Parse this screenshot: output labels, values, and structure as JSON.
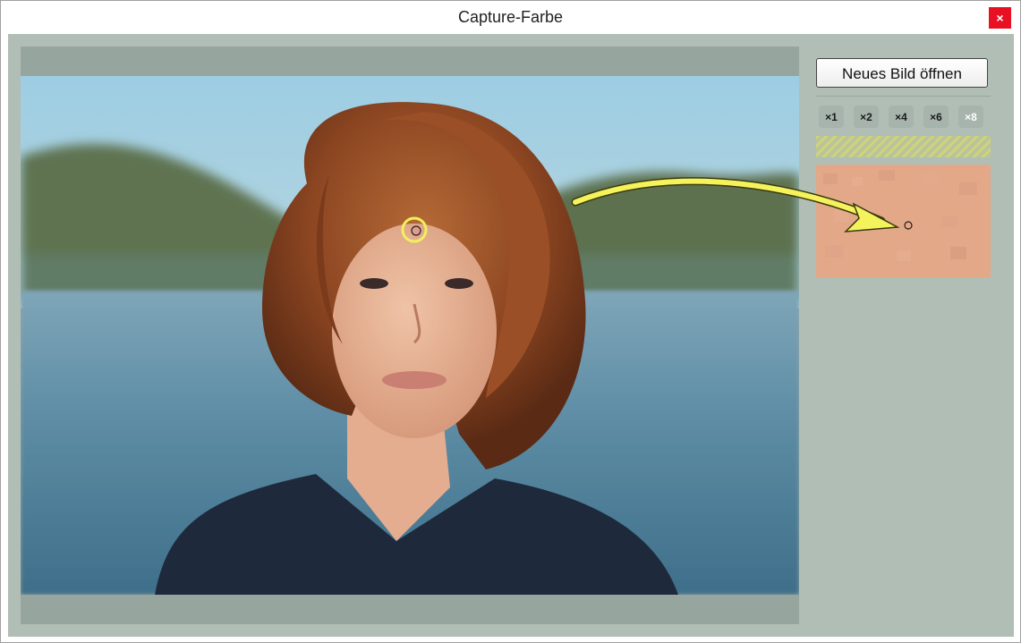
{
  "window": {
    "title": "Capture-Farbe",
    "close_glyph": "×"
  },
  "sidebar": {
    "open_button_label": "Neues Bild öffnen",
    "zoom_options": [
      {
        "label": "×1",
        "active": false
      },
      {
        "label": "×2",
        "active": false
      },
      {
        "label": "×4",
        "active": false
      },
      {
        "label": "×6",
        "active": false
      },
      {
        "label": "×8",
        "active": true
      }
    ]
  },
  "colors": {
    "background": "#b1beb5",
    "image_frame": "#97a59f",
    "sampled_skin": "#e2a888",
    "picker_ring": "#f1f05a",
    "close_button": "#e81123"
  },
  "icons": {
    "close": "close-icon",
    "picker": "picker-ring-icon",
    "arrow": "curved-arrow-icon",
    "cursor_target": "target-dot-icon"
  }
}
